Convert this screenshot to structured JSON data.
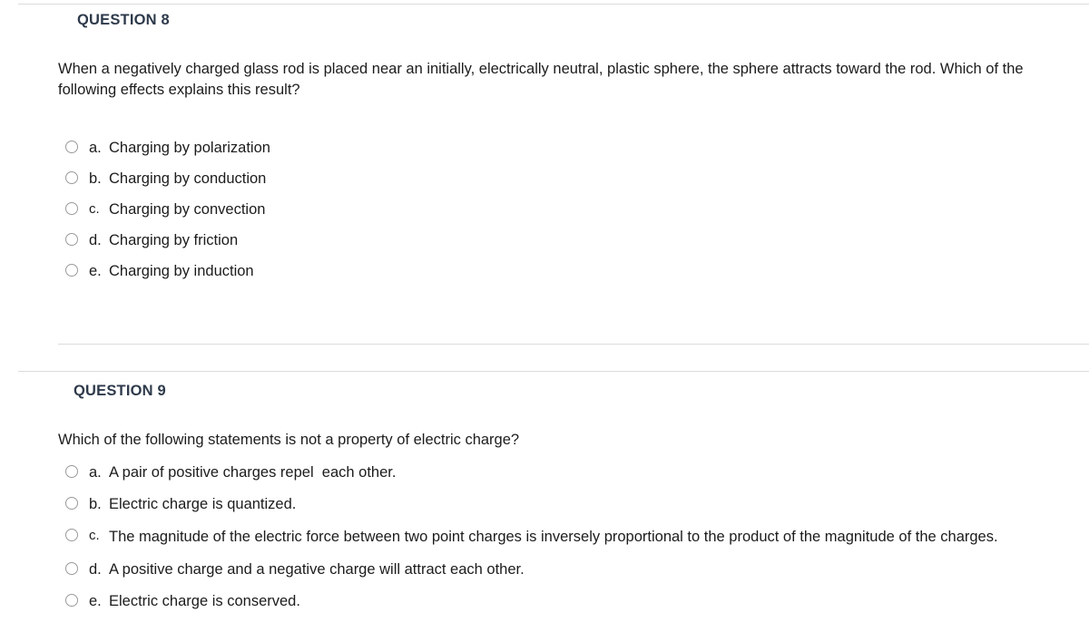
{
  "page": {
    "background_color": "#ffffff",
    "divider_color": "#dcdcdc",
    "header_color": "#2e3a4b",
    "text_color": "#1c1c1c",
    "radio_border_color": "#9a9a9a"
  },
  "questions": [
    {
      "header": "QUESTION 8",
      "text": "When a negatively charged glass rod is placed near an initially, electrically neutral, plastic sphere, the sphere attracts toward the rod. Which of the following effects explains this result?",
      "options": [
        {
          "letter": "a.",
          "text": "Charging by polarization",
          "selected": false
        },
        {
          "letter": "b.",
          "text": "Charging by conduction",
          "selected": false
        },
        {
          "letter": "c.",
          "text": "Charging by convection",
          "selected": false
        },
        {
          "letter": "d.",
          "text": "Charging by friction",
          "selected": false
        },
        {
          "letter": "e.",
          "text": "Charging by induction",
          "selected": false
        }
      ]
    },
    {
      "header": "QUESTION 9",
      "text": "Which of the following statements is not a property of electric charge?",
      "options": [
        {
          "letter": "a.",
          "text": "A pair of positive charges repel  each other.",
          "selected": false
        },
        {
          "letter": "b.",
          "text": "Electric charge is quantized.",
          "selected": false
        },
        {
          "letter": "c.",
          "text": "The magnitude of the electric force between two point charges is inversely proportional to the product of the magnitude of the charges.",
          "selected": false
        },
        {
          "letter": "d.",
          "text": "A positive charge and a negative charge will attract each other.",
          "selected": false
        },
        {
          "letter": "e.",
          "text": "Electric charge is conserved.",
          "selected": false
        }
      ]
    }
  ]
}
